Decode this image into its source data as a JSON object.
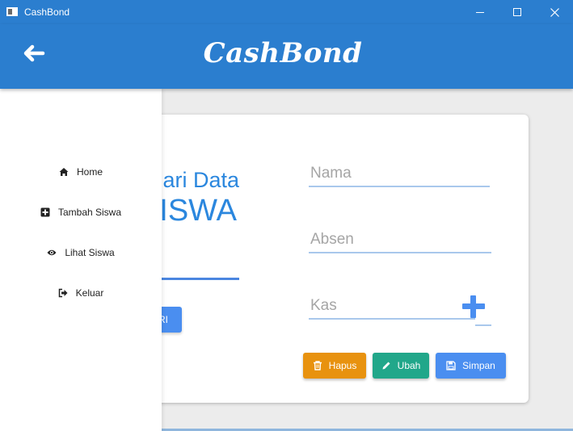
{
  "window": {
    "title": "CashBond"
  },
  "header": {
    "brand": "CashBond",
    "back_icon": "arrow-left-icon"
  },
  "search": {
    "title": "ari Data",
    "subtitle": "ISWA",
    "button_label": "RI"
  },
  "form": {
    "nama_placeholder": "Nama",
    "absen_placeholder": "Absen",
    "kas_placeholder": "Kas",
    "buttons": {
      "hapus": "Hapus",
      "ubah": "Ubah",
      "simpan": "Simpan"
    }
  },
  "sidebar": {
    "items": [
      {
        "label": "Home",
        "icon": "home-icon"
      },
      {
        "label": "Tambah Siswa",
        "icon": "plus-square-icon"
      },
      {
        "label": "Lihat Siswa",
        "icon": "eye-icon"
      },
      {
        "label": "Keluar",
        "icon": "sign-out-icon"
      }
    ]
  },
  "colors": {
    "primary": "#2b7ecf",
    "accent": "#4a8ef0",
    "delete": "#e8920f",
    "edit": "#21a78a"
  }
}
